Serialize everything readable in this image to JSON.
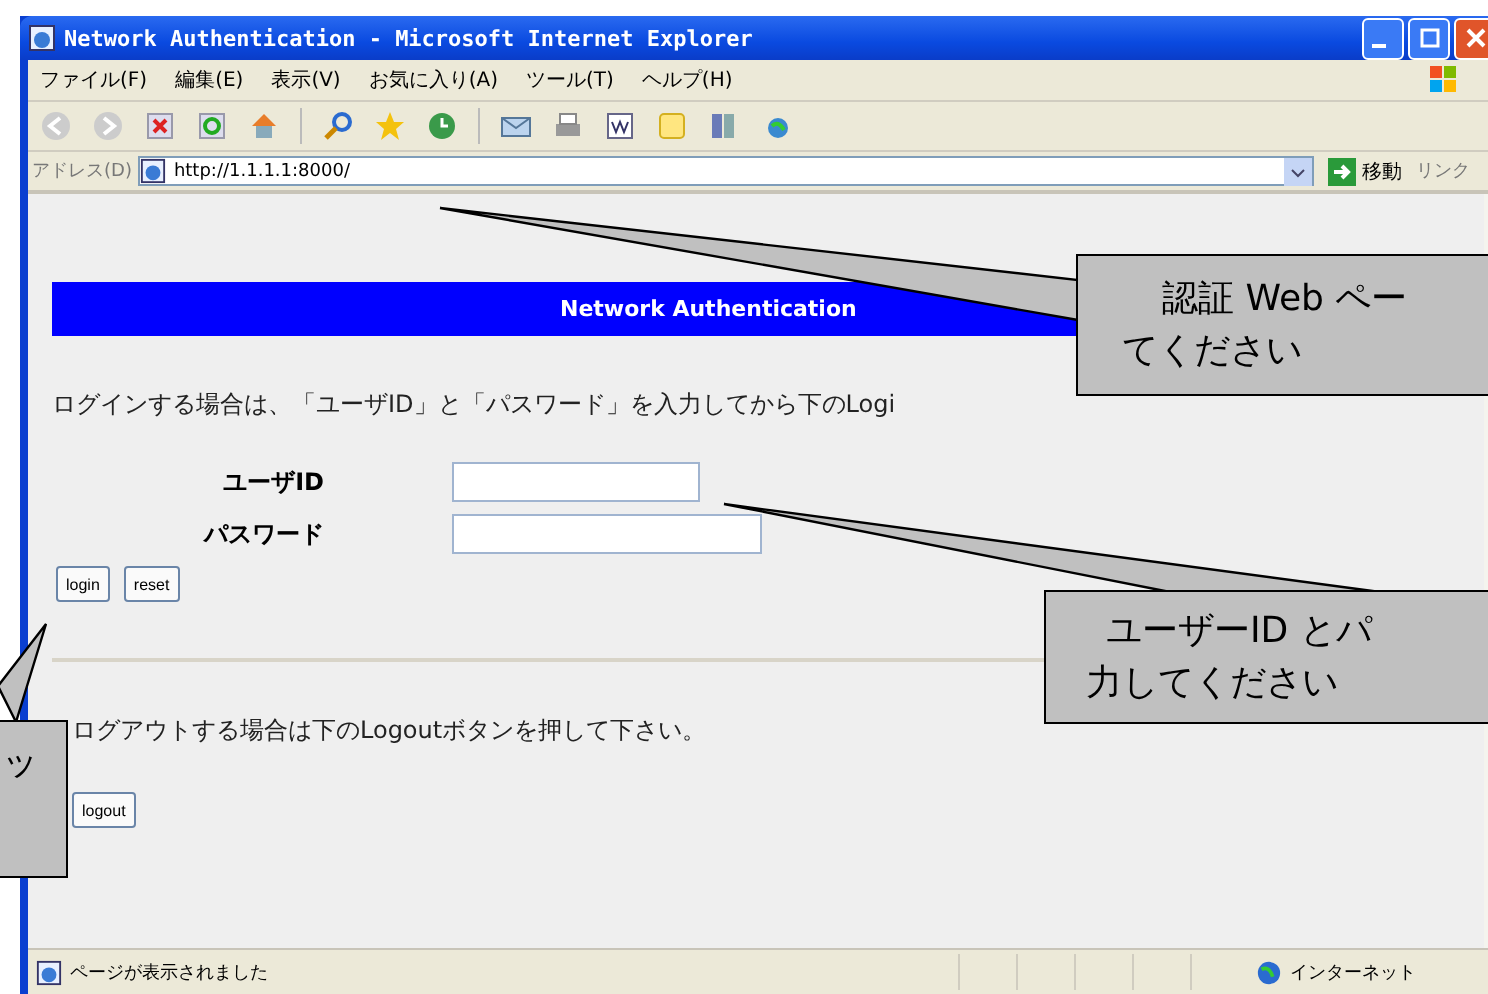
{
  "window": {
    "title": "Network Authentication - Microsoft Internet Explorer"
  },
  "menu": [
    "ファイル(F)",
    "編集(E)",
    "表示(V)",
    "お気に入り(A)",
    "ツール(T)",
    "ヘルプ(H)"
  ],
  "address_bar": {
    "label": "アドレス(D)",
    "value": "http://1.1.1.1:8000/",
    "go": "移動",
    "links": "リンク"
  },
  "page": {
    "banner": "Network Authentication",
    "login_instruction": "ログインする場合は、「ユーザID」と「パスワード」を入力してから下のLogi",
    "fields": [
      {
        "label": "ユーザID",
        "kind": "text"
      },
      {
        "label": "パスワード",
        "kind": "password"
      }
    ],
    "buttons": [
      "login",
      "reset"
    ],
    "logout_instruction": "ログアウトする場合は下のLogoutボタンを押して下さい。",
    "logout_button": "logout"
  },
  "status_bar": {
    "message": "ページが表示されました",
    "zone": "インターネット"
  },
  "callouts": [
    {
      "lines": [
        "認証 Web ペー",
        "てください"
      ]
    },
    {
      "lines": [
        "ユーザーID とパ",
        "力してください"
      ]
    },
    {
      "lines": [
        "ッ"
      ]
    }
  ]
}
